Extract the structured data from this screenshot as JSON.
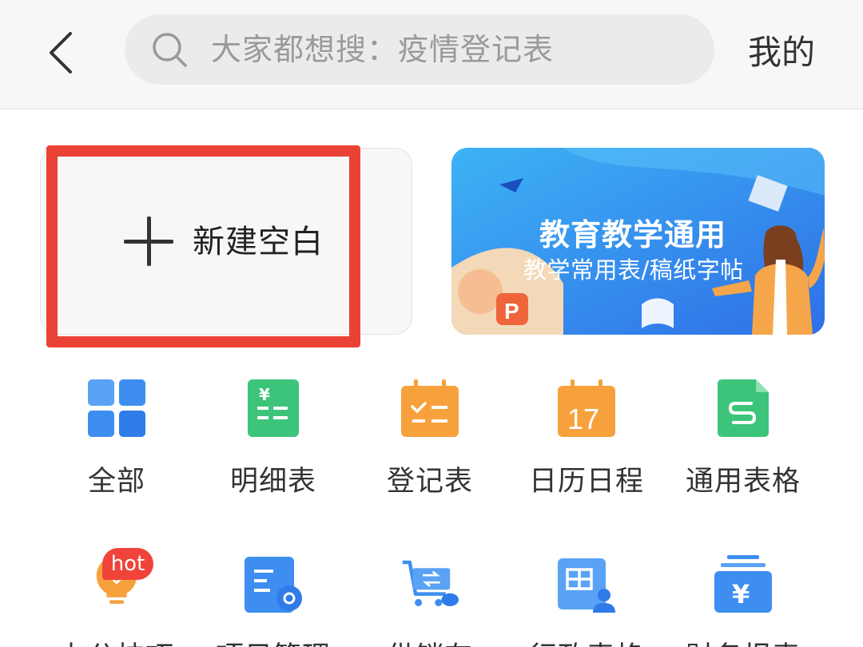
{
  "header": {
    "search_placeholder": "大家都想搜：疫情登记表",
    "mine_label": "我的"
  },
  "new_blank": {
    "label": "新建空白"
  },
  "banner": {
    "title": "教育教学通用",
    "subtitle": "教学常用表/稿纸字帖"
  },
  "categories_row1": [
    {
      "label": "全部",
      "icon": "grid-icon"
    },
    {
      "label": "明细表",
      "icon": "ledger-icon"
    },
    {
      "label": "登记表",
      "icon": "register-icon"
    },
    {
      "label": "日历日程",
      "icon": "calendar-icon",
      "icon_text": "17"
    },
    {
      "label": "通用表格",
      "icon": "spreadsheet-icon"
    }
  ],
  "categories_row2": [
    {
      "label": "办公技巧",
      "icon": "bulb-icon",
      "badge": "hot"
    },
    {
      "label": "项目管理",
      "icon": "project-icon"
    },
    {
      "label": "供销存",
      "icon": "cart-icon"
    },
    {
      "label": "行政表格",
      "icon": "admin-icon"
    },
    {
      "label": "财务报表",
      "icon": "finance-icon"
    }
  ],
  "colors": {
    "highlight": "#ea4335",
    "banner": "#3a8ef0",
    "blue_icon": "#3d8ef0",
    "green_icon": "#3cc47a",
    "orange_icon": "#f7a13c"
  }
}
